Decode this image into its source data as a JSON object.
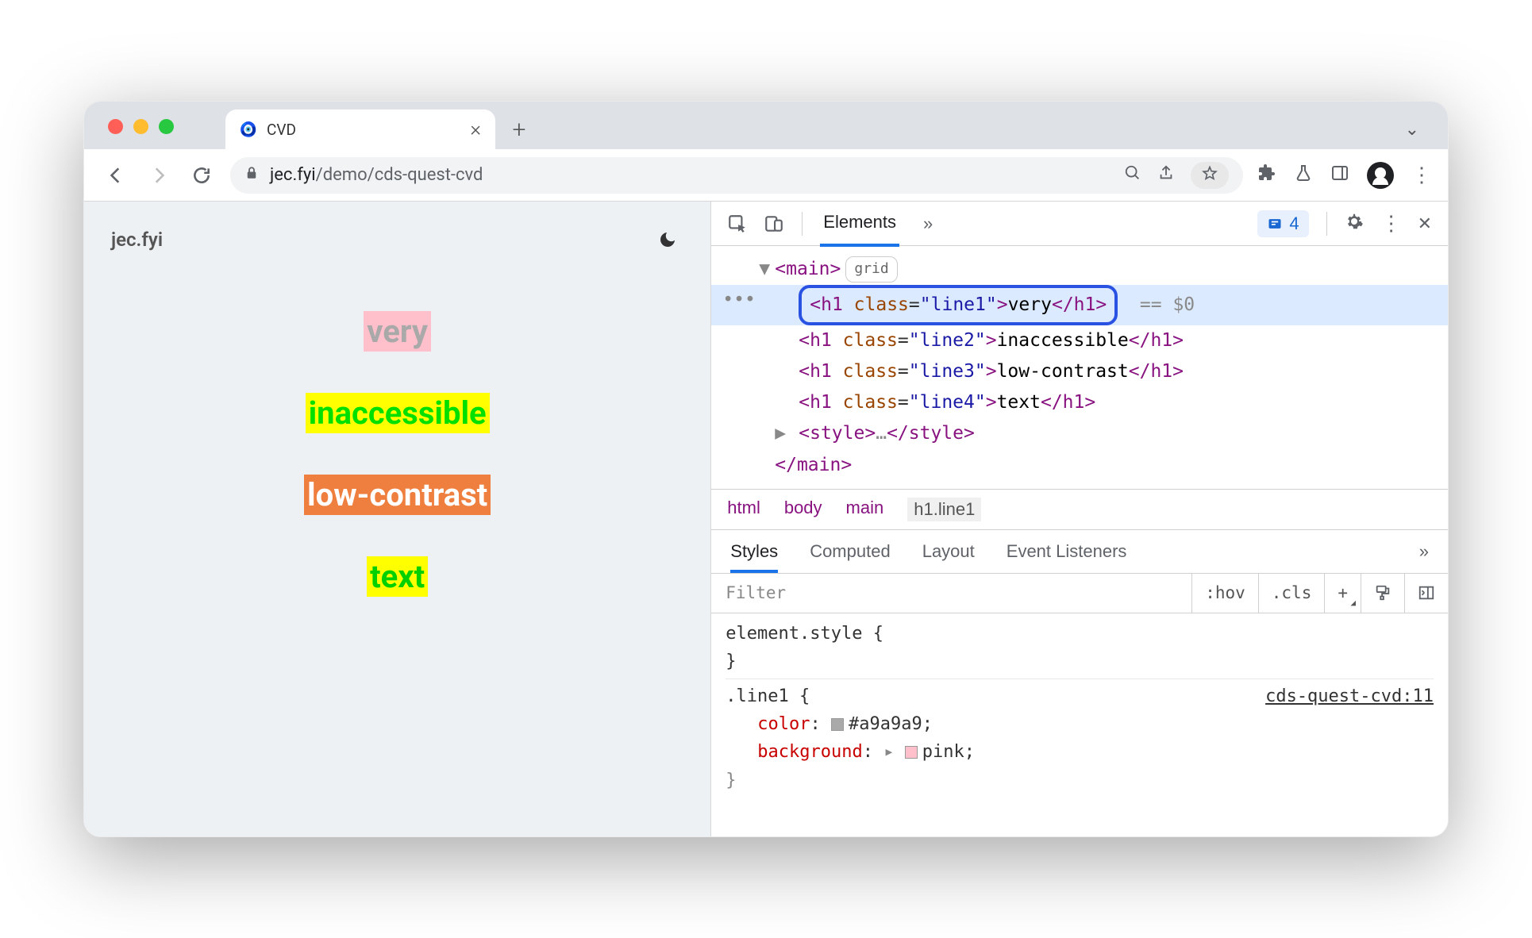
{
  "browser": {
    "tab_title": "CVD",
    "url_domain": "jec.fyi",
    "url_path": "/demo/cds-quest-cvd"
  },
  "page": {
    "brand": "jec.fyi",
    "line1": "very",
    "line2": "inaccessible",
    "line3": "low-contrast",
    "line4": "text"
  },
  "devtools": {
    "panel_active": "Elements",
    "issues_count": "4",
    "dom": {
      "main_badge": "grid",
      "h1_line1_text": "very",
      "h1_line2_text": "inaccessible",
      "h1_line3_text": "low-contrast",
      "h1_line4_text": "text",
      "selected_ref": "== $0"
    },
    "breadcrumbs": {
      "b0": "html",
      "b1": "body",
      "b2": "main",
      "b3": "h1.line1"
    },
    "styles_tabs": {
      "t0": "Styles",
      "t1": "Computed",
      "t2": "Layout",
      "t3": "Event Listeners"
    },
    "filter_placeholder": "Filter",
    "hov": ":hov",
    "cls": ".cls",
    "element_style": "element.style {",
    "rule_selector": ".line1 {",
    "rule_source": "cds-quest-cvd:11",
    "prop_color_name": "color",
    "prop_color_val": "#a9a9a9",
    "prop_bg_name": "background",
    "prop_bg_val": "pink"
  }
}
